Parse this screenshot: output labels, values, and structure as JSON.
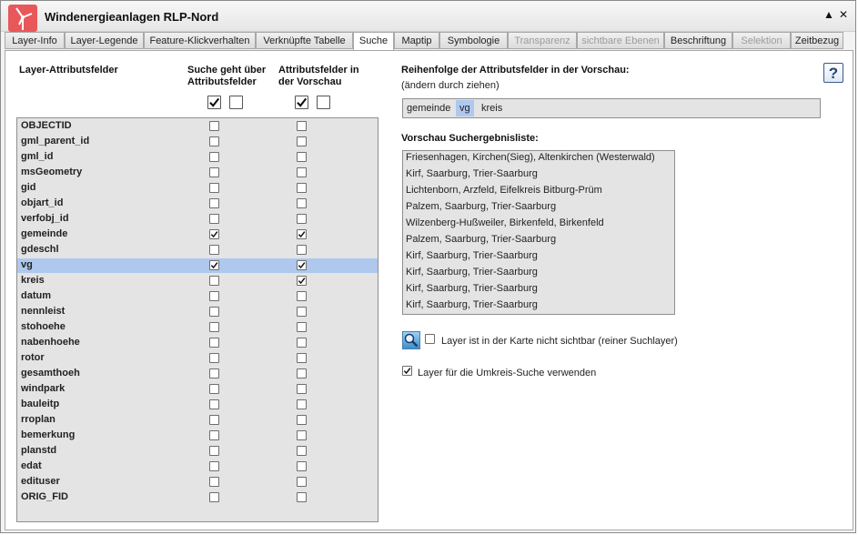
{
  "window": {
    "title": "Windenergieanlagen RLP-Nord",
    "collapse_symbol": "▲",
    "close_symbol": "✕"
  },
  "tabs": [
    {
      "label": "Layer-Info",
      "state": "normal"
    },
    {
      "label": "Layer-Legende",
      "state": "normal"
    },
    {
      "label": "Feature-Klickverhalten",
      "state": "normal"
    },
    {
      "label": "Verknüpfte Tabelle",
      "state": "normal"
    },
    {
      "label": "Suche",
      "state": "active"
    },
    {
      "label": "Maptip",
      "state": "normal"
    },
    {
      "label": "Symbologie",
      "state": "normal"
    },
    {
      "label": "Transparenz",
      "state": "disabled"
    },
    {
      "label": "sichtbare Ebenen",
      "state": "disabled"
    },
    {
      "label": "Beschriftung",
      "state": "normal"
    },
    {
      "label": "Selektion",
      "state": "disabled"
    },
    {
      "label": "Zeitbezug",
      "state": "normal"
    }
  ],
  "left": {
    "col1_header": "Layer-Attributsfelder",
    "col2_header": "Suche geht über Attributsfelder",
    "col3_header": "Attributsfelder in der Vorschau",
    "col2_bulk": {
      "all": true,
      "none": false
    },
    "col3_bulk": {
      "all": true,
      "none": false
    },
    "fields": [
      {
        "name": "OBJECTID",
        "search": false,
        "preview": false,
        "selected": false
      },
      {
        "name": "gml_parent_id",
        "search": false,
        "preview": false,
        "selected": false
      },
      {
        "name": "gml_id",
        "search": false,
        "preview": false,
        "selected": false
      },
      {
        "name": "msGeometry",
        "search": false,
        "preview": false,
        "selected": false
      },
      {
        "name": "gid",
        "search": false,
        "preview": false,
        "selected": false
      },
      {
        "name": "objart_id",
        "search": false,
        "preview": false,
        "selected": false
      },
      {
        "name": "verfobj_id",
        "search": false,
        "preview": false,
        "selected": false
      },
      {
        "name": "gemeinde",
        "search": true,
        "preview": true,
        "selected": false
      },
      {
        "name": "gdeschl",
        "search": false,
        "preview": false,
        "selected": false
      },
      {
        "name": "vg",
        "search": true,
        "preview": true,
        "selected": true
      },
      {
        "name": "kreis",
        "search": false,
        "preview": true,
        "selected": false
      },
      {
        "name": "datum",
        "search": false,
        "preview": false,
        "selected": false
      },
      {
        "name": "nennleist",
        "search": false,
        "preview": false,
        "selected": false
      },
      {
        "name": "stohoehe",
        "search": false,
        "preview": false,
        "selected": false
      },
      {
        "name": "nabenhoehe",
        "search": false,
        "preview": false,
        "selected": false
      },
      {
        "name": "rotor",
        "search": false,
        "preview": false,
        "selected": false
      },
      {
        "name": "gesamthoeh",
        "search": false,
        "preview": false,
        "selected": false
      },
      {
        "name": "windpark",
        "search": false,
        "preview": false,
        "selected": false
      },
      {
        "name": "bauleitp",
        "search": false,
        "preview": false,
        "selected": false
      },
      {
        "name": "rroplan",
        "search": false,
        "preview": false,
        "selected": false
      },
      {
        "name": "bemerkung",
        "search": false,
        "preview": false,
        "selected": false
      },
      {
        "name": "planstd",
        "search": false,
        "preview": false,
        "selected": false
      },
      {
        "name": "edat",
        "search": false,
        "preview": false,
        "selected": false
      },
      {
        "name": "edituser",
        "search": false,
        "preview": false,
        "selected": false
      },
      {
        "name": "ORIG_FID",
        "search": false,
        "preview": false,
        "selected": false
      }
    ]
  },
  "right": {
    "order_header": "Reihenfolge der Attributsfelder in der Vorschau:",
    "order_hint": "(ändern durch ziehen)",
    "order_items": [
      {
        "label": "gemeinde",
        "selected": false
      },
      {
        "label": "vg",
        "selected": true
      },
      {
        "label": "kreis",
        "selected": false
      }
    ],
    "preview_header": "Vorschau Suchergebnisliste:",
    "preview_rows": [
      "Friesenhagen,  Kirchen(Sieg), Altenkirchen (Westerwald)",
      "Kirf,  Saarburg, Trier-Saarburg",
      "Lichtenborn,  Arzfeld, Eifelkreis Bitburg-Prüm",
      "Palzem,  Saarburg, Trier-Saarburg",
      "Wilzenberg-Hußweiler,  Birkenfeld, Birkenfeld",
      "Palzem,  Saarburg, Trier-Saarburg",
      "Kirf,  Saarburg, Trier-Saarburg",
      "Kirf,  Saarburg, Trier-Saarburg",
      "Kirf,  Saarburg, Trier-Saarburg",
      "Kirf,  Saarburg, Trier-Saarburg"
    ],
    "search_layer_label": "Layer ist in der Karte nicht sichtbar (reiner Suchlayer)",
    "search_layer_checked": false,
    "radius_label": "Layer für die Umkreis-Suche verwenden",
    "radius_checked": true,
    "help_label": "?"
  }
}
